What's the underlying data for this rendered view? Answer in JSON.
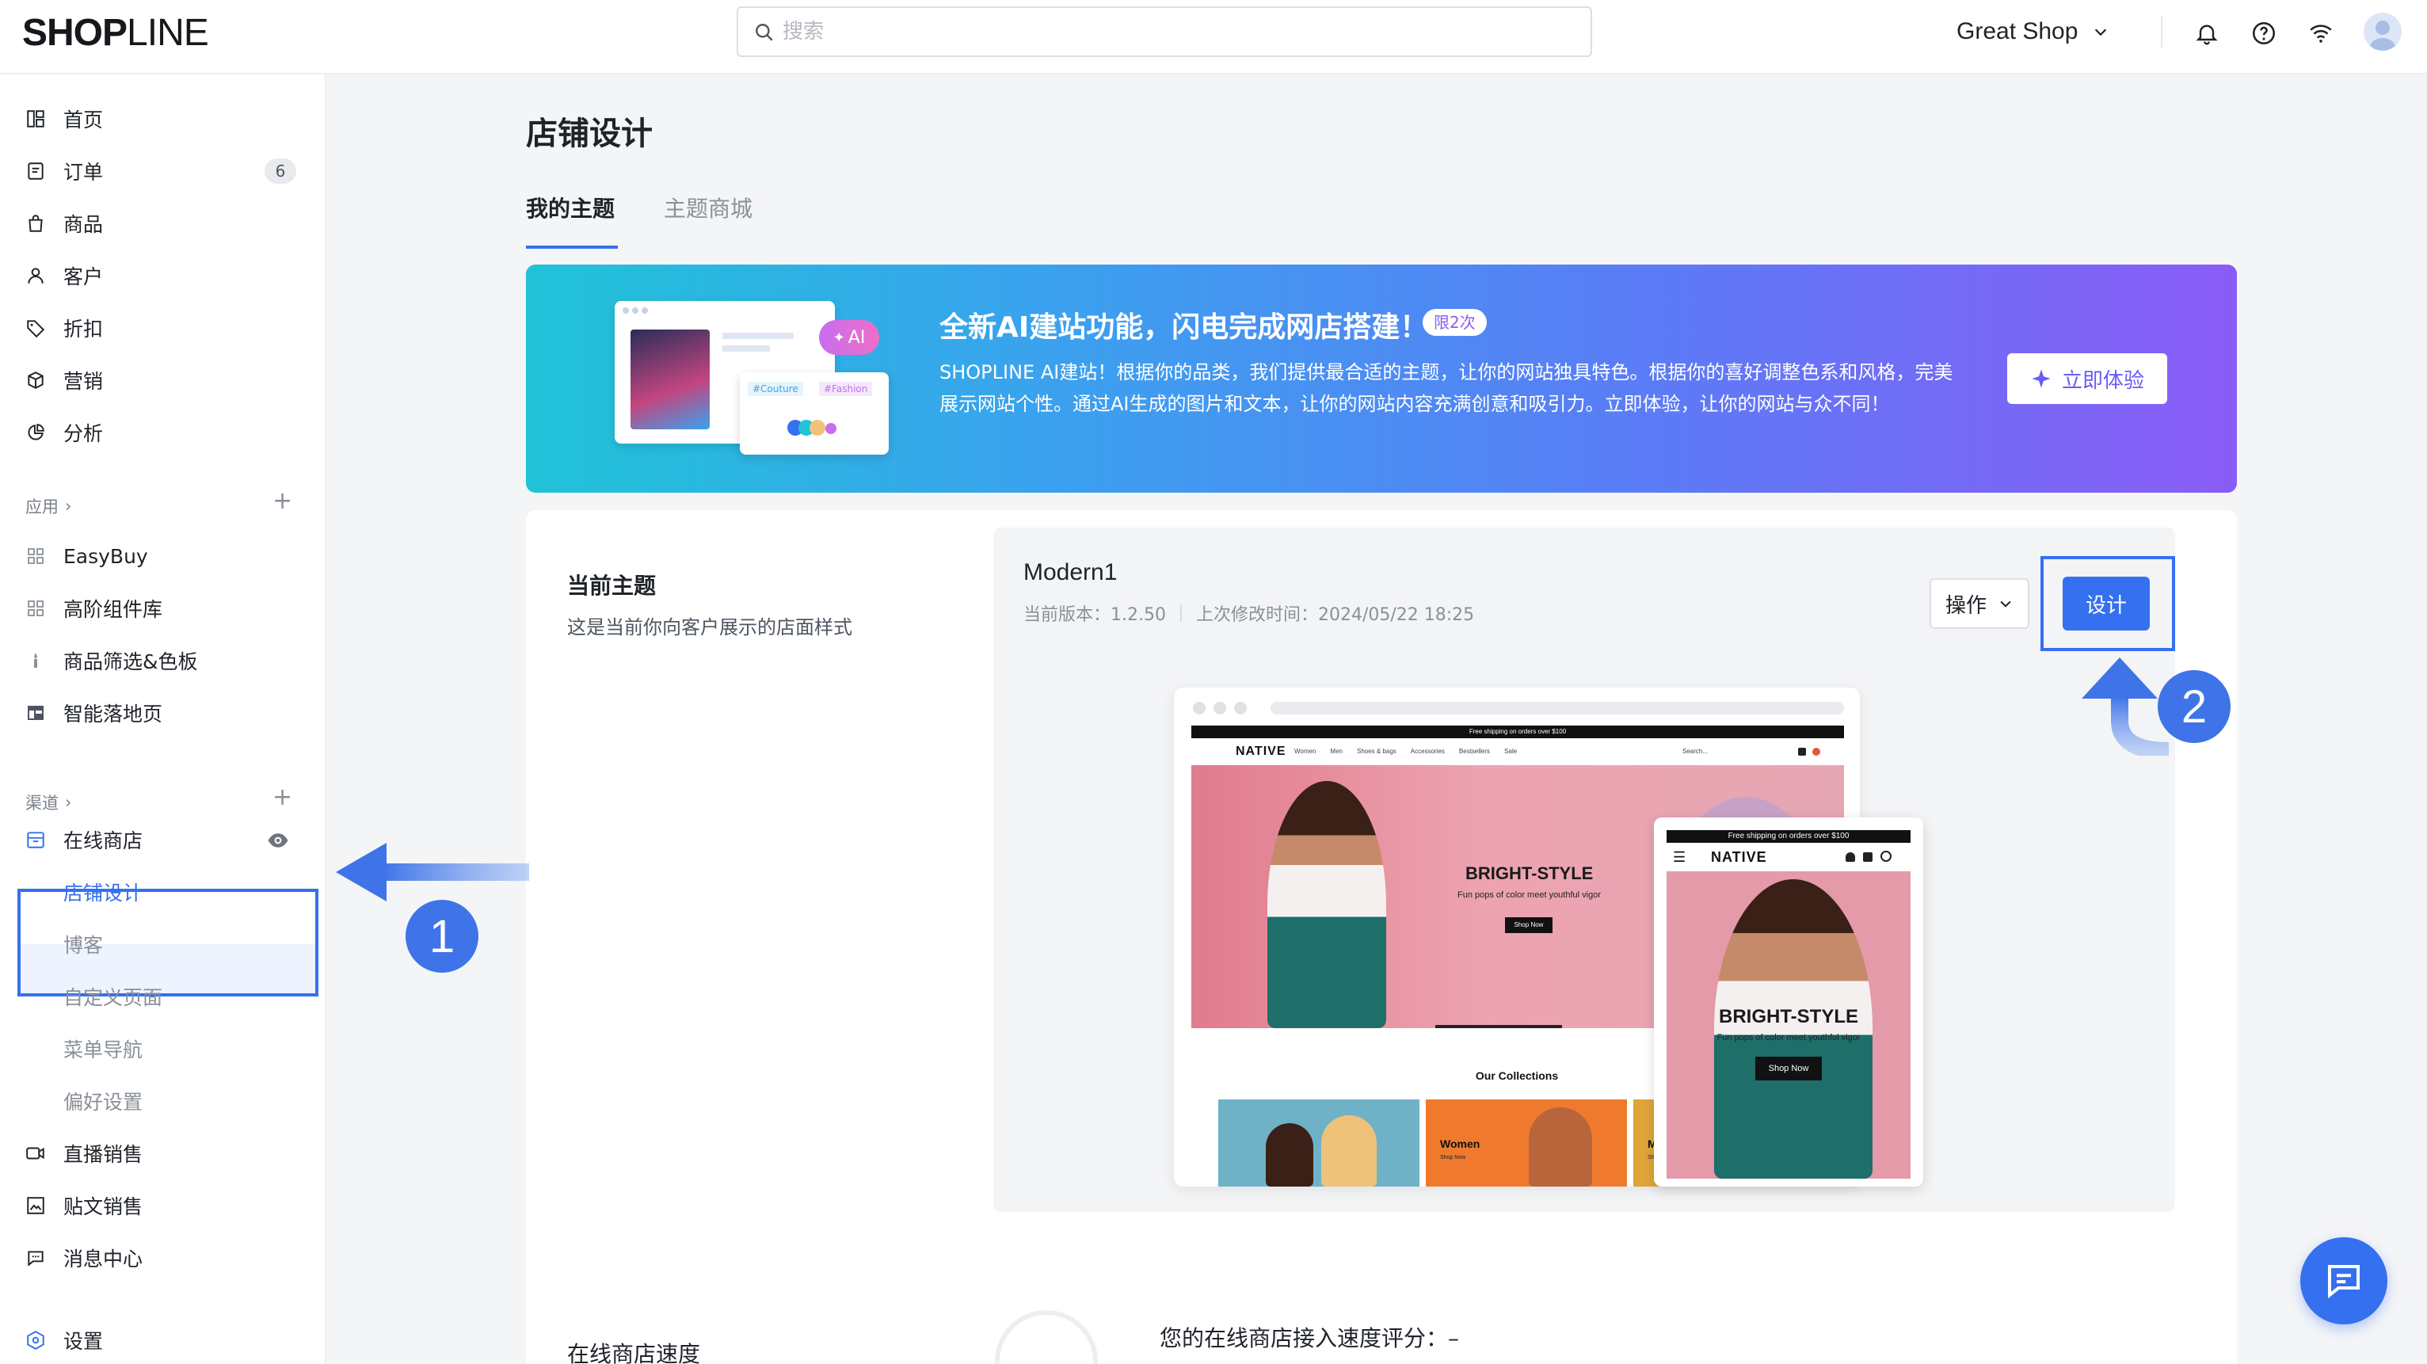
{
  "header": {
    "logo_bold": "SHOP",
    "logo_thin": "LINE",
    "search_placeholder": "搜索",
    "shop_name": "Great Shop"
  },
  "sidebar": {
    "main_items": [
      {
        "label": "首页",
        "icon": "home-icon"
      },
      {
        "label": "订单",
        "icon": "order-icon",
        "badge": "6"
      },
      {
        "label": "商品",
        "icon": "product-bag-icon"
      },
      {
        "label": "客户",
        "icon": "customer-icon"
      },
      {
        "label": "折扣",
        "icon": "discount-tag-icon"
      },
      {
        "label": "营销",
        "icon": "marketing-box-icon"
      },
      {
        "label": "分析",
        "icon": "analytics-pie-icon"
      }
    ],
    "apps_title": "应用",
    "apps": [
      {
        "label": "EasyBuy",
        "icon": "app-grid-icon"
      },
      {
        "label": "高阶组件库",
        "icon": "app-grid-icon"
      },
      {
        "label": "商品筛选&色板",
        "icon": "filter-icon"
      },
      {
        "label": "智能落地页",
        "icon": "landing-page-icon"
      }
    ],
    "channels_title": "渠道",
    "online_store": "在线商店",
    "online_store_subs": [
      "店铺设计",
      "博客",
      "自定义页面",
      "菜单导航",
      "偏好设置"
    ],
    "other_channels": [
      {
        "label": "直播销售",
        "icon": "live-video-icon"
      },
      {
        "label": "贴文销售",
        "icon": "post-icon"
      },
      {
        "label": "消息中心",
        "icon": "message-icon"
      }
    ],
    "settings": "设置"
  },
  "main": {
    "title": "店铺设计",
    "tabs": [
      "我的主题",
      "主题商城"
    ],
    "banner": {
      "title": "全新AI建站功能，闪电完成网店搭建！",
      "tag": "限2次",
      "desc": "SHOPLINE AI建站！根据你的品类，我们提供最合适的主题，让你的网站独具特色。根据你的喜好调整色系和风格，完美展示网站个性。通过AI生成的图片和文本，让你的网站内容充满创意和吸引力。立即体验，让你的网站与众不同！",
      "button": "立即体验",
      "ai_chip": "AI",
      "chip_couture": "#Couture",
      "chip_fashion": "#Fashion"
    },
    "current_theme": {
      "heading": "当前主题",
      "desc": "这是当前你向客户展示的店面样式",
      "name": "Modern1",
      "version_label": "当前版本：1.2.50",
      "modified_label": "上次修改时间：2024/05/22 18:25",
      "ops_button": "操作",
      "design_button": "设计"
    },
    "preview": {
      "promo": "Free shipping on orders over $100",
      "brand": "NATIVE",
      "nav_links": [
        "Women",
        "Men",
        "Shoes & bags",
        "Accessories",
        "Bestsellers",
        "Sale"
      ],
      "search": "Search...",
      "hero_title": "BRIGHT-STYLE",
      "hero_sub": "Fun pops of color meet youthful vigor",
      "hero_btn": "Shop Now",
      "collections_title": "Our Collections",
      "collections": [
        {
          "name": "",
          "color": "#6fb2c8"
        },
        {
          "name": "Women",
          "color": "#ef7a2e"
        },
        {
          "name": "Men",
          "color": "#e0a43a"
        }
      ],
      "collection_cta": "Shop Now"
    },
    "speed": {
      "heading": "在线商店速度",
      "score_label": "您的在线商店接入速度评分：–"
    }
  },
  "annotations": [
    "1",
    "2"
  ],
  "colors": {
    "primary": "#3470f0",
    "banner_start": "#20c3d8",
    "banner_end": "#8a5cf6"
  }
}
